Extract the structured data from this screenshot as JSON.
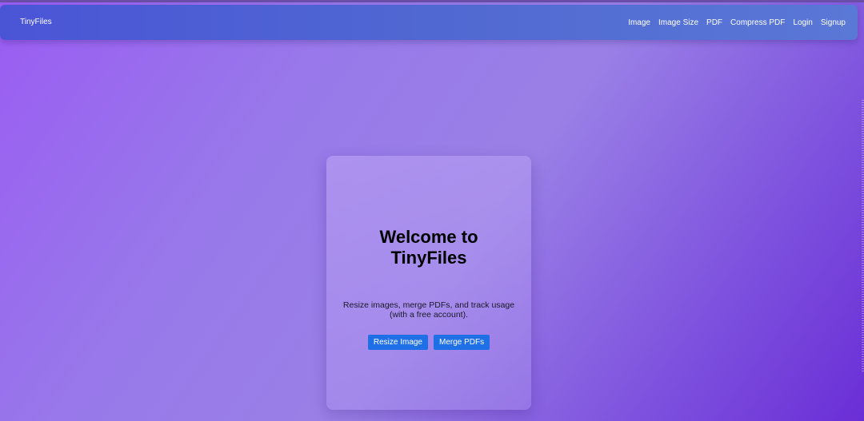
{
  "navbar": {
    "brand": "TinyFiles",
    "links": [
      {
        "label": "Image"
      },
      {
        "label": "Image Size"
      },
      {
        "label": "PDF"
      },
      {
        "label": "Compress PDF"
      },
      {
        "label": "Login"
      },
      {
        "label": "Signup"
      }
    ]
  },
  "hero": {
    "title": "Welcome to TinyFiles",
    "subtitle": "Resize images, merge PDFs, and track usage (with a free account).",
    "buttons": {
      "resize_label": "Resize Image",
      "merge_label": "Merge PDFs"
    }
  },
  "colors": {
    "navbar": "#4f62d4",
    "button": "#1f6fe6",
    "background": "#9a78ea"
  }
}
